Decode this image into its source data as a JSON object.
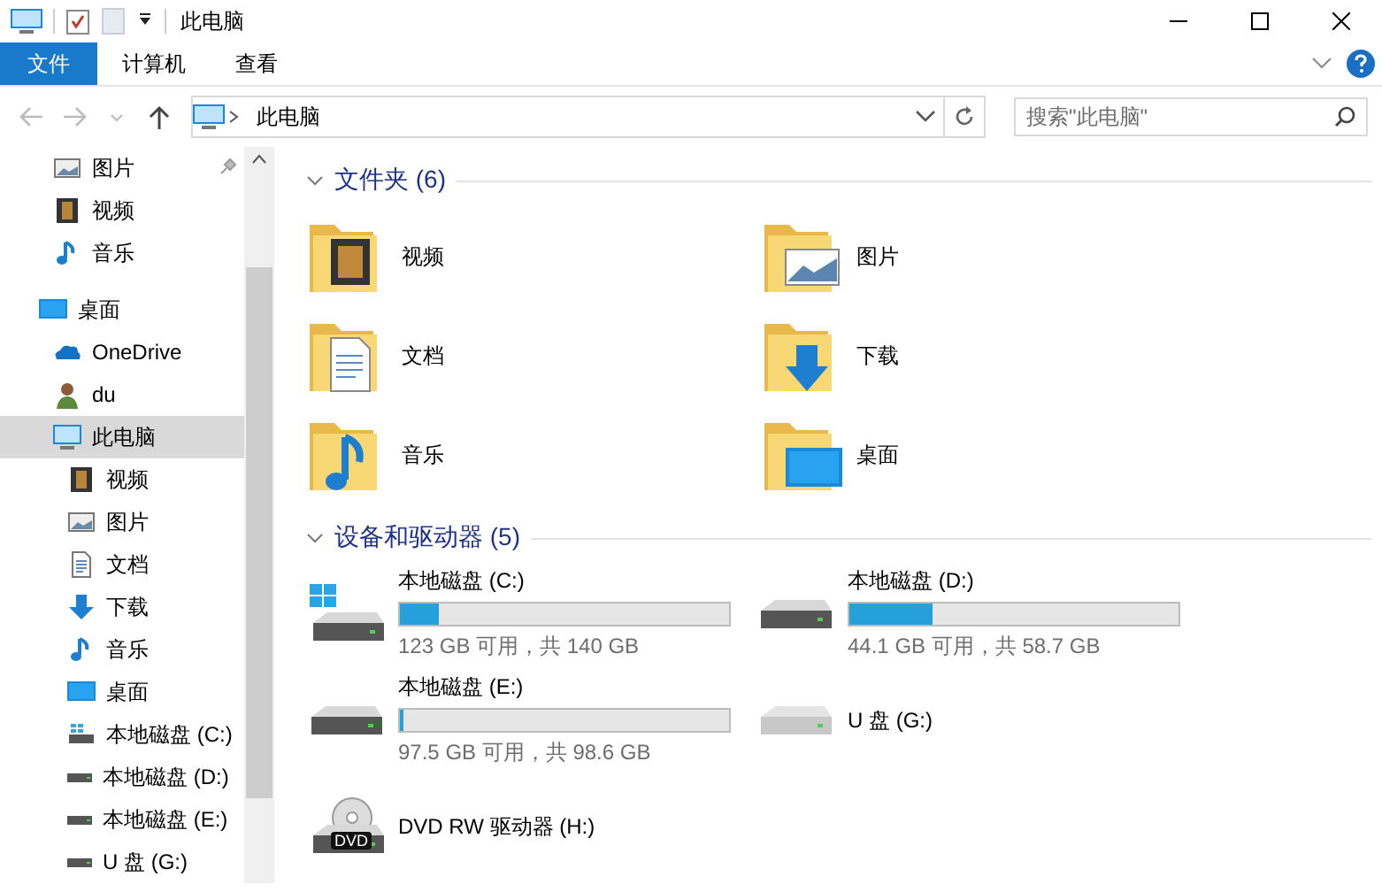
{
  "window": {
    "title": "此电脑"
  },
  "ribbon": {
    "tabs": [
      {
        "label": "文件",
        "kind": "file",
        "selected": false
      },
      {
        "label": "计算机",
        "kind": "tab",
        "selected": false
      },
      {
        "label": "查看",
        "kind": "tab",
        "selected": false
      }
    ]
  },
  "address": {
    "path": "此电脑",
    "search_placeholder": "搜索\"此电脑\""
  },
  "navigation": {
    "quick_access": [
      {
        "label": "图片",
        "kind": "pictures",
        "pinned": true,
        "selected": false
      },
      {
        "label": "视频",
        "kind": "videos",
        "pinned": false,
        "selected": false
      },
      {
        "label": "音乐",
        "kind": "music",
        "pinned": false,
        "selected": false
      }
    ],
    "tree": [
      {
        "label": "桌面",
        "kind": "desktop",
        "selected": false,
        "children": [
          {
            "label": "OneDrive",
            "kind": "onedrive",
            "selected": false
          },
          {
            "label": "du",
            "kind": "user",
            "selected": false
          },
          {
            "label": "此电脑",
            "kind": "pc",
            "selected": true,
            "children": [
              {
                "label": "视频",
                "kind": "videos",
                "selected": false
              },
              {
                "label": "图片",
                "kind": "pictures",
                "selected": false
              },
              {
                "label": "文档",
                "kind": "documents",
                "selected": false
              },
              {
                "label": "下载",
                "kind": "downloads",
                "selected": false
              },
              {
                "label": "音乐",
                "kind": "music",
                "selected": false
              },
              {
                "label": "桌面",
                "kind": "desktop",
                "selected": false
              },
              {
                "label": "本地磁盘 (C:)",
                "kind": "system",
                "selected": false
              },
              {
                "label": "本地磁盘 (D:)",
                "kind": "drive",
                "selected": false
              },
              {
                "label": "本地磁盘 (E:)",
                "kind": "drive",
                "selected": false
              },
              {
                "label": "U 盘 (G:)",
                "kind": "drive",
                "selected": false
              }
            ]
          }
        ]
      }
    ]
  },
  "sections": [
    {
      "title": "文件夹 (6)",
      "kind": "folders",
      "expanded": true,
      "items": [
        {
          "label": "视频",
          "kind": "videos"
        },
        {
          "label": "图片",
          "kind": "pictures"
        },
        {
          "label": "文档",
          "kind": "documents"
        },
        {
          "label": "下载",
          "kind": "downloads"
        },
        {
          "label": "音乐",
          "kind": "music"
        },
        {
          "label": "桌面",
          "kind": "desktop"
        }
      ]
    },
    {
      "title": "设备和驱动器 (5)",
      "kind": "drives",
      "expanded": true,
      "items": [
        {
          "label": "本地磁盘 (C:)",
          "kind": "system",
          "level": 0.12,
          "reading": "123 GB 可用，共 140 GB"
        },
        {
          "label": "本地磁盘 (D:)",
          "kind": "drive",
          "level": 0.25,
          "reading": "44.1 GB 可用，共 58.7 GB"
        },
        {
          "label": "本地磁盘 (E:)",
          "kind": "drive",
          "level": 0.011,
          "reading": "97.5 GB 可用，共 98.6 GB"
        },
        {
          "label": "U 盘 (G:)",
          "kind": "usb"
        },
        {
          "label": "DVD RW 驱动器 (H:)",
          "kind": "dvd",
          "badge": "DVD"
        }
      ]
    }
  ]
}
